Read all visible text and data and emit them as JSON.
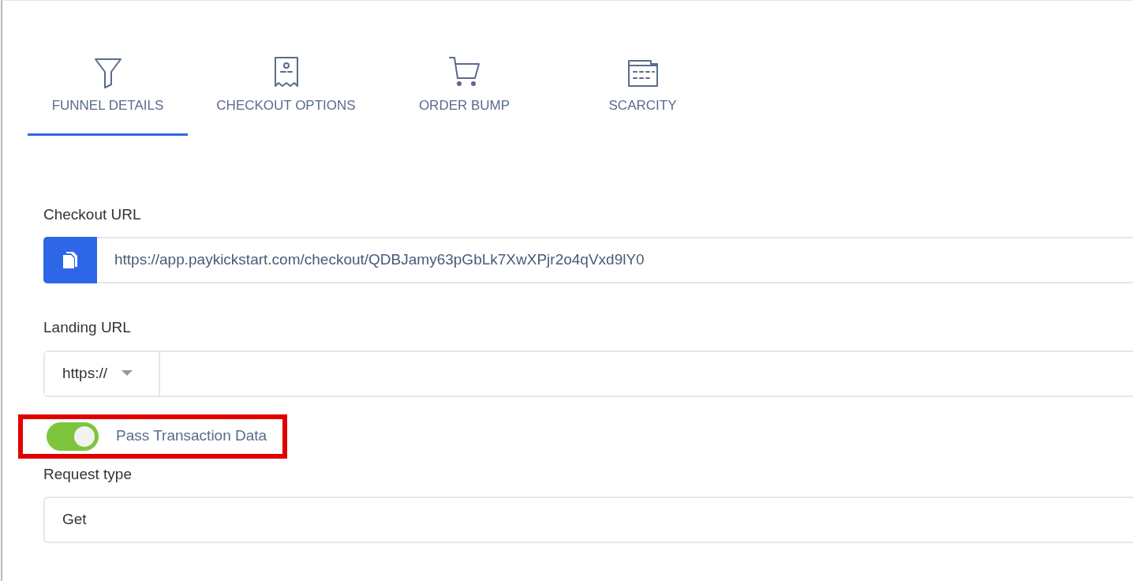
{
  "tabs": [
    {
      "label": "FUNNEL DETAILS",
      "selected": true
    },
    {
      "label": "CHECKOUT OPTIONS",
      "selected": false
    },
    {
      "label": "ORDER BUMP",
      "selected": false
    },
    {
      "label": "SCARCITY",
      "selected": false
    }
  ],
  "fields": [
    {
      "kind": "copy",
      "label": "Checkout URL",
      "value": "https://app.paykickstart.com/checkout/QDBJamy63pGbLk7XwXPjr2o4qVxd9lY0"
    },
    {
      "kind": "protocol",
      "label": "Landing URL",
      "protocol": "https://"
    },
    {
      "kind": "toggle",
      "label": "Pass Transaction Data",
      "on": true,
      "highlighted": true
    },
    {
      "kind": "select",
      "label": "Request type",
      "value": "Get"
    }
  ]
}
